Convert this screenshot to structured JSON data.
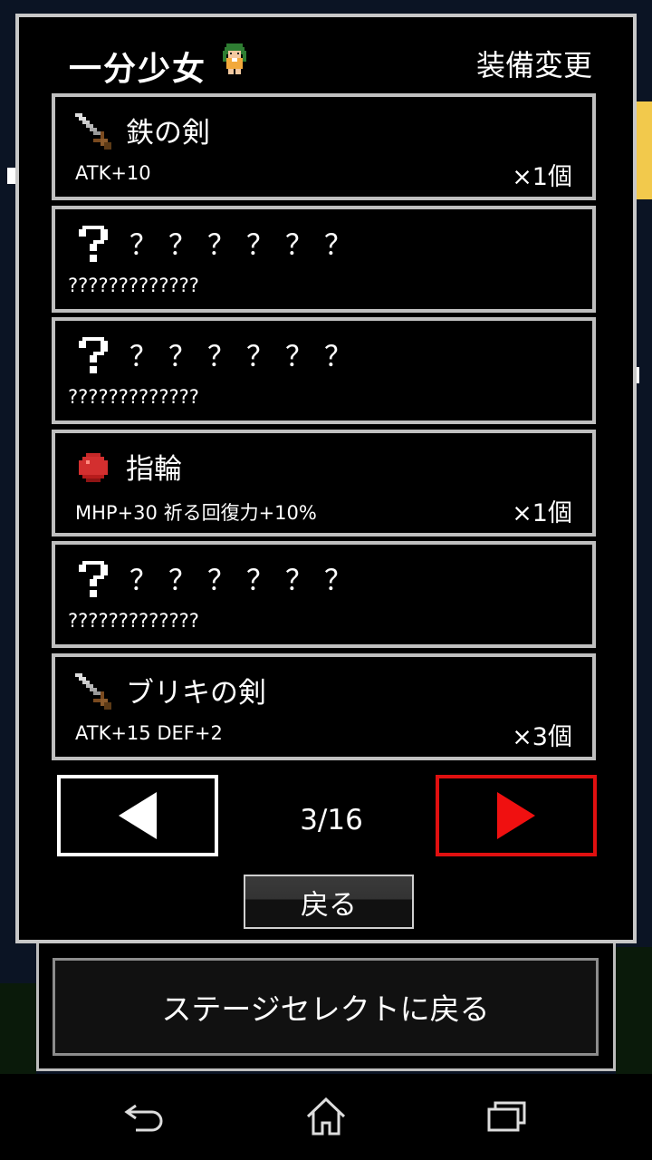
{
  "header": {
    "app_title": "一分少女",
    "screen_title": "装備変更"
  },
  "items": [
    {
      "icon": "sword-icon",
      "name": "鉄の剣",
      "desc": "ATK+10",
      "count": "×1個"
    },
    {
      "icon": "question-icon",
      "name": "？？？？？？",
      "desc": "?????????????",
      "count": ""
    },
    {
      "icon": "question-icon",
      "name": "？？？？？？",
      "desc": "?????????????",
      "count": ""
    },
    {
      "icon": "ring-icon",
      "name": "指輪",
      "desc": "MHP+30 祈る回復力+10%",
      "count": "×1個"
    },
    {
      "icon": "question-icon",
      "name": "？？？？？？",
      "desc": "?????????????",
      "count": ""
    },
    {
      "icon": "sword-icon",
      "name": "ブリキの剣",
      "desc": "ATK+15 DEF+2",
      "count": "×3個"
    }
  ],
  "pagination": {
    "indicator": "3/16",
    "prev_icon": "triangle-left-icon",
    "next_icon": "triangle-right-icon"
  },
  "buttons": {
    "back_label": "戻る",
    "stage_select_label": "ステージセレクトに戻る"
  },
  "system_nav": {
    "back_icon": "back-arrow-icon",
    "home_icon": "home-icon",
    "recents_icon": "recents-icon"
  },
  "colors": {
    "next_button_accent": "#e01010",
    "item_border": "#bfbfbf",
    "background": "#000000"
  }
}
